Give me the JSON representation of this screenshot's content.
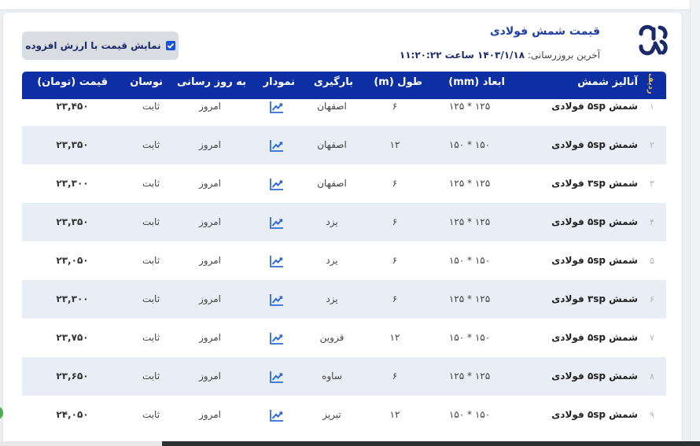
{
  "header": {
    "title": "قیمت شمش فولادی",
    "updated_label": "آخرین بروزرسانی:",
    "updated_value": "۱۴۰۳/۱/۱۸ ساعت ۱۱:۲۰:۲۲",
    "vat_toggle_label": "نمایش قیمت با ارزش افزوده",
    "vat_checked": true
  },
  "colors": {
    "accent": "#0d2fa3",
    "row_alt": "#e9eef6",
    "logo": "#1a2a6b"
  },
  "table": {
    "columns": {
      "index": "ردیف",
      "name": "آنالیز شمش",
      "dim": "ابعاد (mm)",
      "length": "طول (m)",
      "loading": "بارگیری",
      "chart": "نمودار",
      "delivery": "به روز رسانی",
      "fluctuation": "نوسان",
      "price": "قیمت (تومان)"
    },
    "rows": [
      {
        "index": "۱",
        "name": "شمش ۵sp فولادی",
        "dim": "۱۲۵ * ۱۲۵",
        "length": "۶",
        "loading": "اصفهان",
        "chart_icon": "chart-line-icon",
        "delivery": "امروز",
        "fluctuation": "ثابت",
        "price": "۲۳,۴۵۰"
      },
      {
        "index": "۲",
        "name": "شمش ۵sp فولادی",
        "dim": "۱۵۰ * ۱۵۰",
        "length": "۱۲",
        "loading": "اصفهان",
        "chart_icon": "chart-line-icon",
        "delivery": "امروز",
        "fluctuation": "ثابت",
        "price": "۲۳,۳۵۰"
      },
      {
        "index": "۳",
        "name": "شمش ۳sp فولادی",
        "dim": "۱۲۵ * ۱۲۵",
        "length": "۶",
        "loading": "اصفهان",
        "chart_icon": "chart-line-icon",
        "delivery": "امروز",
        "fluctuation": "ثابت",
        "price": "۲۳,۳۰۰"
      },
      {
        "index": "۴",
        "name": "شمش ۵sp فولادی",
        "dim": "۱۲۵ * ۱۲۵",
        "length": "۶",
        "loading": "یزد",
        "chart_icon": "chart-line-icon",
        "delivery": "امروز",
        "fluctuation": "ثابت",
        "price": "۲۳,۳۵۰"
      },
      {
        "index": "۵",
        "name": "شمش ۵sp فولادی",
        "dim": "۱۵۰ * ۱۵۰",
        "length": "۶",
        "loading": "یزد",
        "chart_icon": "chart-line-icon",
        "delivery": "امروز",
        "fluctuation": "ثابت",
        "price": "۲۳,۰۵۰"
      },
      {
        "index": "۶",
        "name": "شمش ۳sp فولادی",
        "dim": "۱۲۵ * ۱۲۵",
        "length": "۶",
        "loading": "یزد",
        "chart_icon": "chart-line-icon",
        "delivery": "امروز",
        "fluctuation": "ثابت",
        "price": "۲۳,۳۰۰"
      },
      {
        "index": "۷",
        "name": "شمش ۵sp فولادی",
        "dim": "۱۵۰ * ۱۵۰",
        "length": "۱۲",
        "loading": "قزوین",
        "chart_icon": "chart-line-icon",
        "delivery": "امروز",
        "fluctuation": "ثابت",
        "price": "۲۳,۷۵۰"
      },
      {
        "index": "۸",
        "name": "شمش ۵sp فولادی",
        "dim": "۱۲۵ * ۱۲۵",
        "length": "۶",
        "loading": "ساوه",
        "chart_icon": "chart-line-icon",
        "delivery": "امروز",
        "fluctuation": "ثابت",
        "price": "۲۳,۶۵۰"
      },
      {
        "index": "۹",
        "name": "شمش ۵sp فولادی",
        "dim": "۱۵۰ * ۱۵۰",
        "length": "۱۲",
        "loading": "تبریز",
        "chart_icon": "chart-line-icon",
        "delivery": "امروز",
        "fluctuation": "ثابت",
        "price": "۲۴,۰۵۰"
      }
    ]
  }
}
